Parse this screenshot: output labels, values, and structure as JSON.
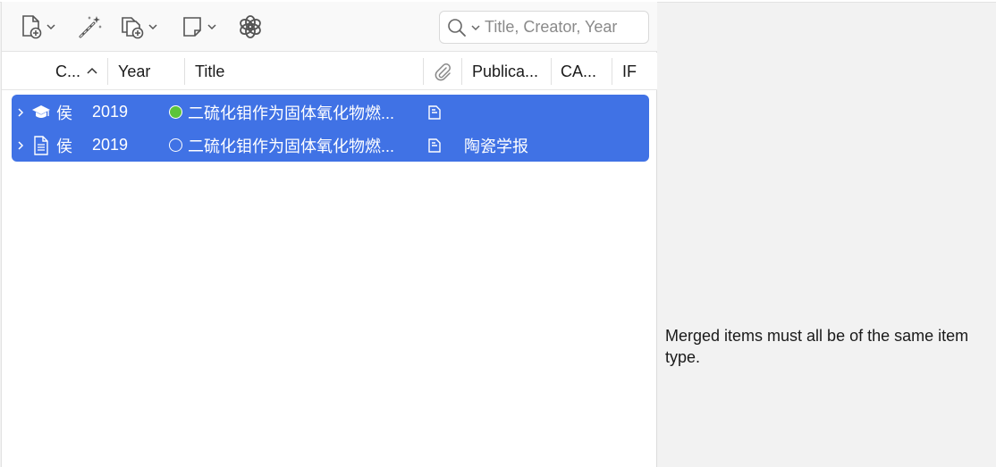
{
  "toolbar": {
    "new_item_icon": "new-item-icon",
    "magic_wand_icon": "magic-wand-icon",
    "add_attachment_icon": "add-attachment-icon",
    "new_note_icon": "new-note-icon",
    "openai_icon": "openai-icon"
  },
  "search": {
    "placeholder": "Title, Creator, Year"
  },
  "columns": {
    "creator": "C...",
    "year": "Year",
    "title": "Title",
    "publication": "Publica...",
    "cas": "CA...",
    "if": "IF"
  },
  "rows": [
    {
      "type_icon": "thesis-icon",
      "creator": "侯",
      "year": "2019",
      "status_color": "#5cc43a",
      "title": "二硫化钼作为固体氧化物燃...",
      "publication": ""
    },
    {
      "type_icon": "journal-article-icon",
      "creator": "侯",
      "year": "2019",
      "status_color": "",
      "title": "二硫化钼作为固体氧化物燃...",
      "publication": "陶瓷学报"
    }
  ],
  "message": "Merged items must all be of the same item type.",
  "colors": {
    "selection": "#4072e5",
    "pane_bg": "#f2f2f2"
  }
}
